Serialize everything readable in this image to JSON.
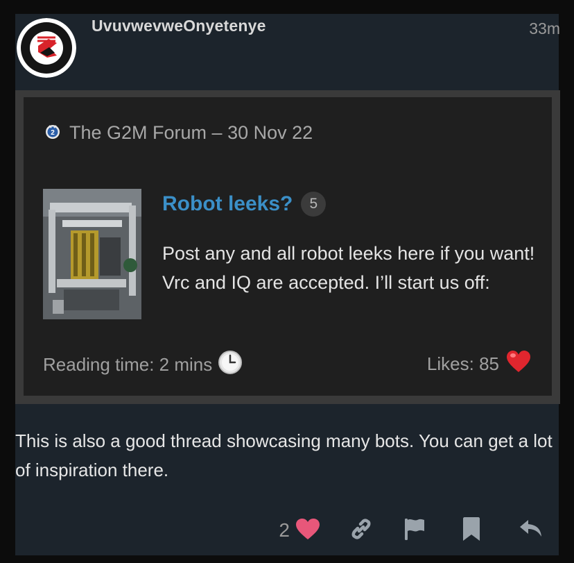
{
  "post": {
    "username": "UvuvwevweOnyetenye",
    "time_ago": "33m",
    "body": "This is also a good thread showcasing many bots. You can get a lot of inspiration there."
  },
  "onebox": {
    "source": "The G2M Forum – 30 Nov 22",
    "source_badge": "2",
    "topic_title": "Robot leeks?",
    "reply_count": "5",
    "excerpt": "Post any and all robot leeks here if you want! Vrc and IQ are accepted. I’ll start us off:",
    "reading_time": "Reading time: 2 mins",
    "likes": "Likes: 85"
  },
  "actions": {
    "like_count": "2"
  },
  "colors": {
    "post_bg": "#1c242c",
    "link": "#3b8fc7",
    "like_heart": "#e8577a",
    "action_icon": "#9aa3ab"
  },
  "icons": [
    "clock-icon",
    "heart-icon",
    "link-icon",
    "flag-icon",
    "bookmark-icon",
    "reply-icon"
  ]
}
